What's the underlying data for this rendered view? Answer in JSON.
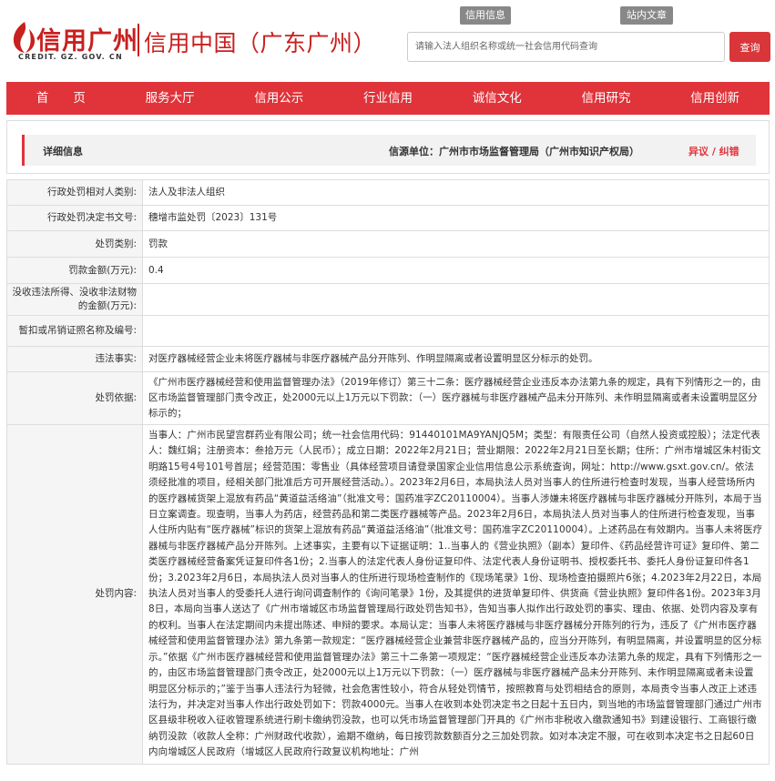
{
  "header": {
    "logo_cn": "信用广州",
    "logo_en": "CREDIT. GZ. GOV. CN",
    "site_title": "信用中国（广东广州）",
    "tab_credit_info": "信用信息",
    "tab_site_search": "站内文章",
    "search_placeholder": "请输入法人组织名称或统一社会信用代码查询",
    "search_button": "查询"
  },
  "nav": {
    "items": [
      "首　　页",
      "服务大厅",
      "信用公示",
      "行业信用",
      "诚信文化",
      "信用研究",
      "信用创新"
    ]
  },
  "detail": {
    "label": "详细信息",
    "source": "信源单位：广州市市场监督管理局（广州市知识产权局）",
    "report": "异议 / 纠错"
  },
  "rows": [
    {
      "label": "行政处罚相对人类别:",
      "value": "法人及非法人组织"
    },
    {
      "label": "行政处罚决定书文号:",
      "value": "穗增市监处罚〔2023〕131号"
    },
    {
      "label": "处罚类别:",
      "value": "罚款"
    },
    {
      "label": "罚款金额(万元):",
      "value": "0.4"
    },
    {
      "label": "没收违法所得、没收非法财物的金额(万元):",
      "value": ""
    },
    {
      "label": "暂扣或吊销证照名称及编号:",
      "value": ""
    },
    {
      "label": "违法事实:",
      "value": "对医疗器械经营企业未将医疗器械与非医疗器械产品分开陈列、作明显隔离或者设置明显区分标示的处罚。"
    },
    {
      "label": "处罚依据:",
      "value": "《广州市医疗器械经营和使用监督管理办法》（2019年修订）第三十二条：医疗器械经营企业违反本办法第九条的规定，具有下列情形之一的，由区市场监督管理部门责令改正，处2000元以上1万元以下罚款：（一）医疗器械与非医疗器械产品未分开陈列、未作明显隔离或者未设置明显区分标示的；"
    },
    {
      "label": "处罚内容:",
      "value": "当事人：广州市民望宫群药业有限公司；统一社会信用代码：91440101MA9YANJQ5M；类型：有限责任公司（自然人投资或控股）；法定代表人：魏红娟；注册资本：叁拾万元（人民币）；成立日期：2022年2月21日；营业期限：2022年2月21日至长期；住所：广州市增城区朱村街文明路15号4号101号首层；经营范围：零售业（具体经营项目请登录国家企业信用信息公示系统查询，网址：http://www.gsxt.gov.cn/。依法须经批准的项目，经相关部门批准后方可开展经营活动。）。2023年2月6日，本局执法人员对当事人的住所进行检查时发现，当事人经营场所内的医疗器械货架上混放有药品“黄道益活络油”（批准文号：国药准字ZC20110004）。当事人涉嫌未将医疗器械与非医疗器械分开陈列，本局于当日立案调查。现查明，当事人为药店，经营药品和第二类医疗器械等产品。2023年2月6日，本局执法人员对当事人的住所进行检查发现，当事人住所内贴有“医疗器械”标识的货架上混放有药品“黄道益活络油”（批准文号：国药准字ZC20110004）。上述药品在有效期内。当事人未将医疗器械与非医疗器械产品分开陈列。上述事实，主要有以下证据证明：1..当事人的《营业执照》（副本）复印件、《药品经营许可证》复印件、第二类医疗器械经营备案凭证复印件各1份；2.当事人的法定代表人身份证复印件、法定代表人身份证明书、授权委托书、委托人身份证复印件各1份；3.2023年2月6日，本局执法人员对当事人的住所进行现场检查制作的《现场笔录》1份、现场检查拍摄照片6张；4.2023年2月22日，本局执法人员对当事人的受委托人进行询问调查制作的《询问笔录》1份，及其提供的进货单复印件、供货商《营业执照》复印件各1份。2023年3月8日，本局向当事人送达了《广州市增城区市场监督管理局行政处罚告知书》，告知当事人拟作出行政处罚的事实、理由、依据、处罚内容及享有的权利。当事人在法定期间内未提出陈述、申辩的要求。本局认定：当事人未将医疗器械与非医疗器械分开陈列的行为，违反了《广州市医疗器械经营和使用监督管理办法》第九条第一款规定：“医疗器械经营企业兼营非医疗器械产品的，应当分开陈列，有明显隔离，并设置明显的区分标示。”依据《广州市医疗器械经营和使用监督管理办法》第三十二条第一项规定：“医疗器械经营企业违反本办法第九条的规定，具有下列情形之一的，由区市场监督管理部门责令改正，处2000元以上1万元以下罚款：（一）医疗器械与非医疗器械产品未分开陈列、未作明显隔离或者未设置明显区分标示的；”鉴于当事人违法行为轻微，社会危害性较小，符合从轻处罚情节，按照教育与处罚相结合的原则，本局责令当事人改正上述违法行为，并决定对当事人作出行政处罚如下：罚款4000元。当事人在收到本处罚决定书之日起十五日内，到当地的市场监督管理部门通过广州市区县级非税收入征收管理系统进行刷卡缴纳罚没款，也可以凭市场监督管理部门开具的《广州市非税收入缴款通知书》到建设银行、工商银行缴纳罚没款（收款人全称：广州财政代收款），逾期不缴纳，每日按罚款数额百分之三加处罚款。如对本决定不服，可在收到本决定书之日起60日内向增城区人民政府（增城区人民政府行政复议机构地址：广州"
    }
  ],
  "colors": {
    "brand_red": "#e0333a",
    "logo_red": "#c8201f"
  }
}
